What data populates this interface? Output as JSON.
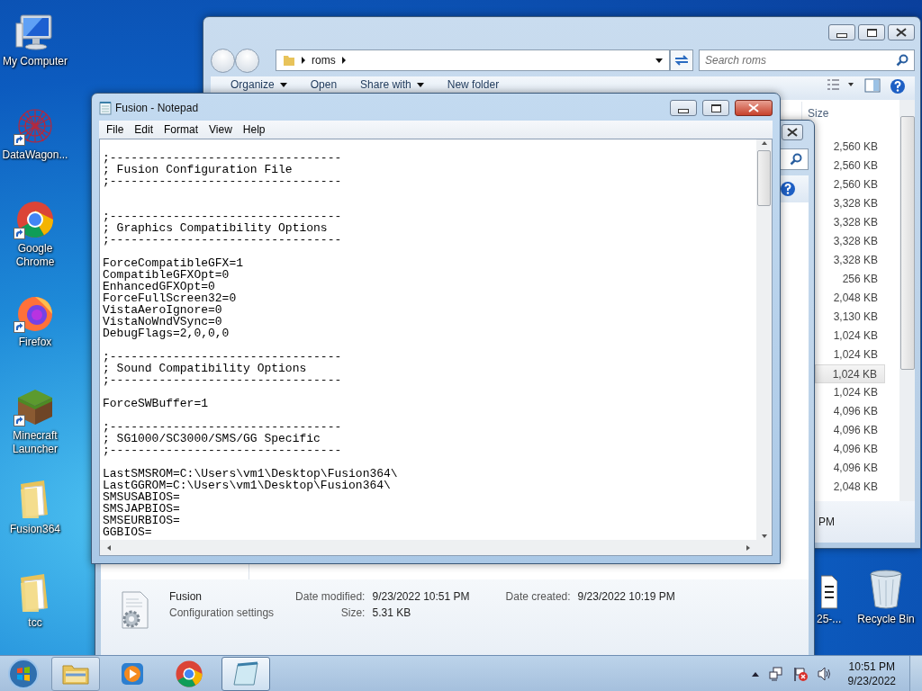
{
  "left_icons": [
    {
      "label": "My Computer",
      "kind": "computer",
      "shortcut": false
    },
    {
      "label": "DataWagon...",
      "kind": "web",
      "shortcut": true
    },
    {
      "label": "Google Chrome",
      "kind": "chrome",
      "shortcut": true
    },
    {
      "label": "Firefox",
      "kind": "firefox",
      "shortcut": true
    },
    {
      "label": "Minecraft Launcher",
      "kind": "grass",
      "shortcut": true
    },
    {
      "label": "Fusion364",
      "kind": "folder",
      "shortcut": false
    },
    {
      "label": "tcc",
      "kind": "folder",
      "shortcut": false
    }
  ],
  "right_icons": [
    {
      "label": "25-...",
      "kind": "document"
    },
    {
      "label": "Recycle Bin",
      "kind": "bin"
    }
  ],
  "explorer": {
    "address": [
      "roms"
    ],
    "search": {
      "placeholder": "Search roms"
    },
    "toolbar": [
      {
        "label": "Organize",
        "dropdown": true
      },
      {
        "label": "Open",
        "dropdown": false
      },
      {
        "label": "Share with",
        "dropdown": true
      },
      {
        "label": "New folder",
        "dropdown": false
      }
    ],
    "size_header": "Size",
    "sizes": [
      {
        "text": "2,560 KB",
        "selected": false
      },
      {
        "text": "2,560 KB",
        "selected": false
      },
      {
        "text": "2,560 KB",
        "selected": false
      },
      {
        "text": "3,328 KB",
        "selected": false
      },
      {
        "text": "3,328 KB",
        "selected": false
      },
      {
        "text": "3,328 KB",
        "selected": false
      },
      {
        "text": "3,328 KB",
        "selected": false
      },
      {
        "text": "256 KB",
        "selected": false
      },
      {
        "text": "2,048 KB",
        "selected": false
      },
      {
        "text": "3,130 KB",
        "selected": false
      },
      {
        "text": "1,024 KB",
        "selected": false
      },
      {
        "text": "1,024 KB",
        "selected": false
      },
      {
        "text": "1,024 KB",
        "selected": true
      },
      {
        "text": "1,024 KB",
        "selected": false
      },
      {
        "text": "4,096 KB",
        "selected": false
      },
      {
        "text": "4,096 KB",
        "selected": false
      },
      {
        "text": "4,096 KB",
        "selected": false
      },
      {
        "text": "4,096 KB",
        "selected": false
      },
      {
        "text": "2,048 KB",
        "selected": false
      }
    ],
    "details_fragment": "PM"
  },
  "back_window": {
    "details": {
      "name": "Fusion",
      "type": "Configuration settings",
      "fields": [
        {
          "label": "Date modified:",
          "value": "9/23/2022 10:51 PM"
        },
        {
          "label": "Size:",
          "value": "5.31 KB"
        },
        {
          "label": "Date created:",
          "value": "9/23/2022 10:19 PM"
        }
      ]
    }
  },
  "notepad": {
    "title": "Fusion - Notepad",
    "menu": [
      "File",
      "Edit",
      "Format",
      "View",
      "Help"
    ],
    "text": "\n;---------------------------------\n; Fusion Configuration File\n;---------------------------------\n\n\n;---------------------------------\n; Graphics Compatibility Options\n;---------------------------------\n\nForceCompatibleGFX=1\nCompatibleGFXOpt=0\nEnhancedGFXOpt=0\nForceFullScreen32=0\nVistaAeroIgnore=0\nVistaNoWndVSync=0\nDebugFlags=2,0,0,0\n\n;---------------------------------\n; Sound Compatibility Options\n;---------------------------------\n\nForceSWBuffer=1\n\n;---------------------------------\n; SG1000/SC3000/SMS/GG Specific\n;---------------------------------\n\nLastSMSROM=C:\\Users\\vm1\\Desktop\\Fusion364\\\nLastGGROM=C:\\Users\\vm1\\Desktop\\Fusion364\\\nSMSUSABIOS=\nSMSJAPBIOS=\nSMSEURBIOS=\nGGBIOS="
  },
  "taskbar": {
    "apps": [
      {
        "kind": "explorer",
        "running": true,
        "selected": false
      },
      {
        "kind": "media",
        "running": false,
        "selected": false
      },
      {
        "kind": "chrome",
        "running": false,
        "selected": false
      },
      {
        "kind": "notepad",
        "running": true,
        "selected": true
      }
    ],
    "time": "10:51 PM",
    "date": "9/23/2022"
  }
}
